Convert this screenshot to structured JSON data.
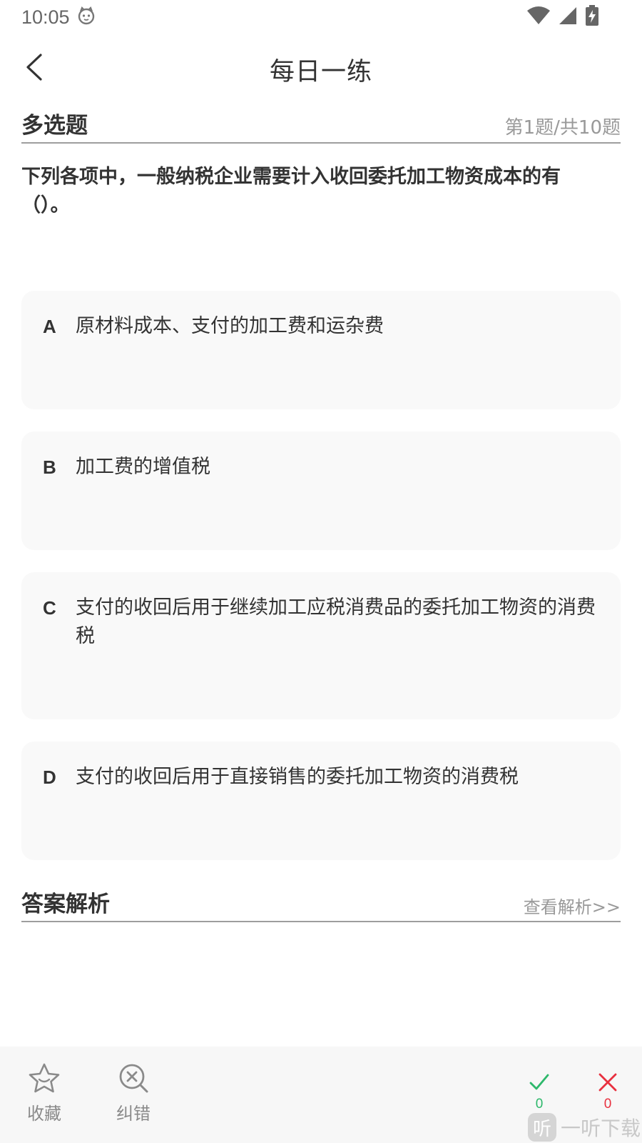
{
  "status_bar": {
    "time": "10:05",
    "icons": [
      "cat-face-icon",
      "wifi-icon",
      "signal-icon",
      "battery-charging-icon"
    ]
  },
  "header": {
    "title": "每日一练",
    "back_icon": "chevron-left-icon"
  },
  "question": {
    "type_label": "多选题",
    "progress": "第1题/共10题",
    "text": "下列各项中，一般纳税企业需要计入收回委托加工物资成本的有（）。"
  },
  "options": [
    {
      "letter": "A",
      "text": "原材料成本、支付的加工费和运杂费"
    },
    {
      "letter": "B",
      "text": "加工费的增值税"
    },
    {
      "letter": "C",
      "text": "支付的收回后用于继续加工应税消费品的委托加工物资的消费税"
    },
    {
      "letter": "D",
      "text": "支付的收回后用于直接销售的委托加工物资的消费税"
    }
  ],
  "analysis": {
    "title": "答案解析",
    "link": "查看解析>>"
  },
  "bottom_bar": {
    "favorite_label": "收藏",
    "favorite_icon": "star-icon",
    "correct_error_label": "纠错",
    "correct_error_icon": "search-x-icon",
    "correct_count": "0",
    "wrong_count": "0",
    "correct_color": "#2db86b",
    "wrong_color": "#e8303f"
  },
  "watermark": {
    "mark": "听",
    "text": "一听下载"
  }
}
